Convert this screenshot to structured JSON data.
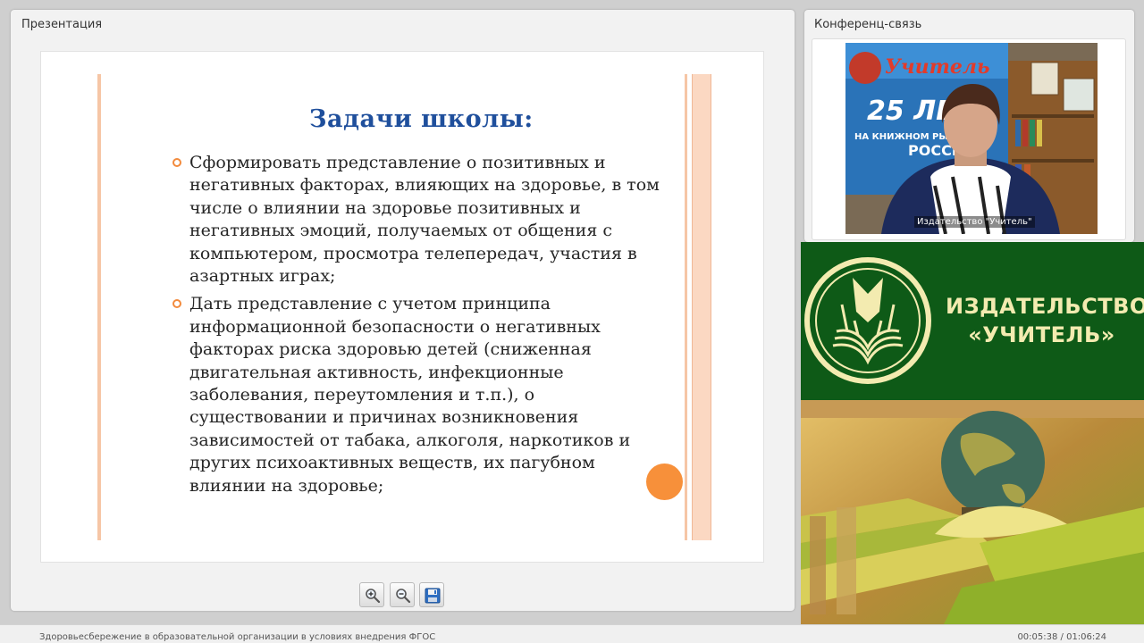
{
  "presentation": {
    "panel_title": "Презентация",
    "slide": {
      "title": "Задачи школы:",
      "bullets": [
        "Сформировать представление о позитивных и негативных факторах, влияющих на здоровье, в том числе о влиянии на здоровье позитивных и негативных эмоций, получаемых от общения с компьютером, просмотра телепередач, участия в азартных играх;",
        "Дать представление с учетом принципа информационной безопасности о негативных факторах риска здоровью детей (сниженная двигательная активность, инфекционные заболевания, переутомления и т.п.), о существовании и причинах возникновения зависимостей от табака, алкоголя, наркотиков и других психоактивных веществ, их пагубном влиянии на здоровье;"
      ],
      "accent_color": "#f7903a",
      "title_color": "#1f4f9c"
    },
    "toolbar": {
      "zoom_in_icon": "zoom-in-icon",
      "zoom_out_icon": "zoom-out-icon",
      "save_icon": "floppy-disk-icon"
    }
  },
  "conference": {
    "panel_title": "Конференц-связь",
    "video_caption": "Издательство \"Учитель\""
  },
  "banner": {
    "line1": "ИЗДАТЕЛЬСТВО",
    "line2": "«УЧИТЕЛЬ»",
    "brand_green": "#0e5a17",
    "brand_cream": "#f3ebb0"
  },
  "footer": {
    "title": "Здоровьесбережение в образовательной организации в условиях внедрения ФГОС",
    "time": "00:05:38 / 01:06:24"
  }
}
